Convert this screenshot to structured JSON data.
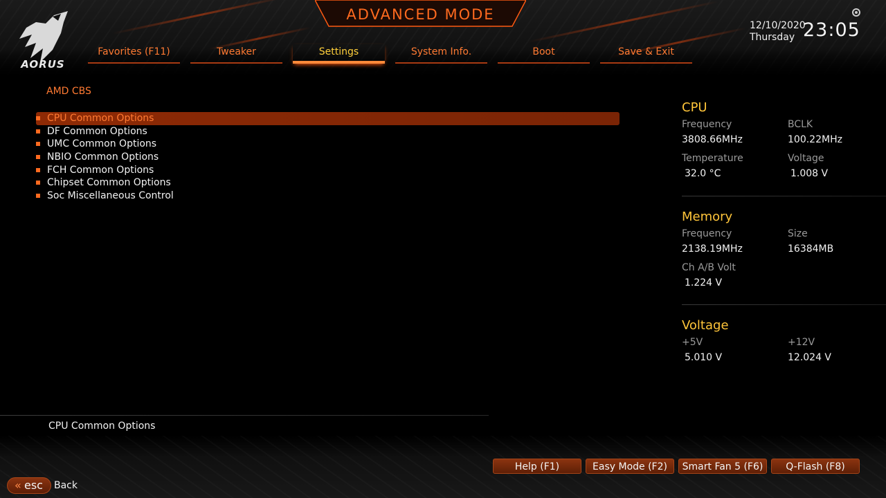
{
  "brand": {
    "logo_text": "AORUS"
  },
  "header": {
    "title": "ADVANCED MODE",
    "date": "12/10/2020",
    "weekday": "Thursday",
    "time": "23:05"
  },
  "tabs": [
    {
      "label": "Favorites (F11)",
      "active": false
    },
    {
      "label": "Tweaker",
      "active": false
    },
    {
      "label": "Settings",
      "active": true
    },
    {
      "label": "System Info.",
      "active": false
    },
    {
      "label": "Boot",
      "active": false
    },
    {
      "label": "Save & Exit",
      "active": false
    }
  ],
  "main": {
    "breadcrumb": "AMD CBS",
    "items": [
      "CPU Common Options",
      "DF Common Options",
      "UMC Common Options",
      "NBIO Common Options",
      "FCH Common Options",
      "Chipset Common Options",
      "Soc Miscellaneous Control"
    ],
    "selected_item": "CPU Common Options"
  },
  "panel": {
    "cpu": {
      "title": "CPU",
      "frequency_label": "Frequency",
      "frequency": "3808.66MHz",
      "bclk_label": "BCLK",
      "bclk": "100.22MHz",
      "temperature_label": "Temperature",
      "temperature": "32.0 °C",
      "voltage_label": "Voltage",
      "voltage": "1.008 V"
    },
    "memory": {
      "title": "Memory",
      "frequency_label": "Frequency",
      "frequency": "2138.19MHz",
      "size_label": "Size",
      "size": "16384MB",
      "chab_label": "Ch A/B Volt",
      "chab": "1.224 V"
    },
    "voltage": {
      "title": "Voltage",
      "p5v_label": "+5V",
      "p5v": "5.010 V",
      "p12v_label": "+12V",
      "p12v": "12.024 V"
    }
  },
  "help": {
    "text": "CPU Common Options"
  },
  "footer": {
    "buttons": [
      "Help (F1)",
      "Easy Mode (F2)",
      "Smart Fan 5 (F6)",
      "Q-Flash (F8)"
    ],
    "esc_label": "esc",
    "back_label": "Back"
  },
  "colors": {
    "accent": "#ff6a1f",
    "highlight": "#ffc53a",
    "selection": "#8e2a05"
  }
}
